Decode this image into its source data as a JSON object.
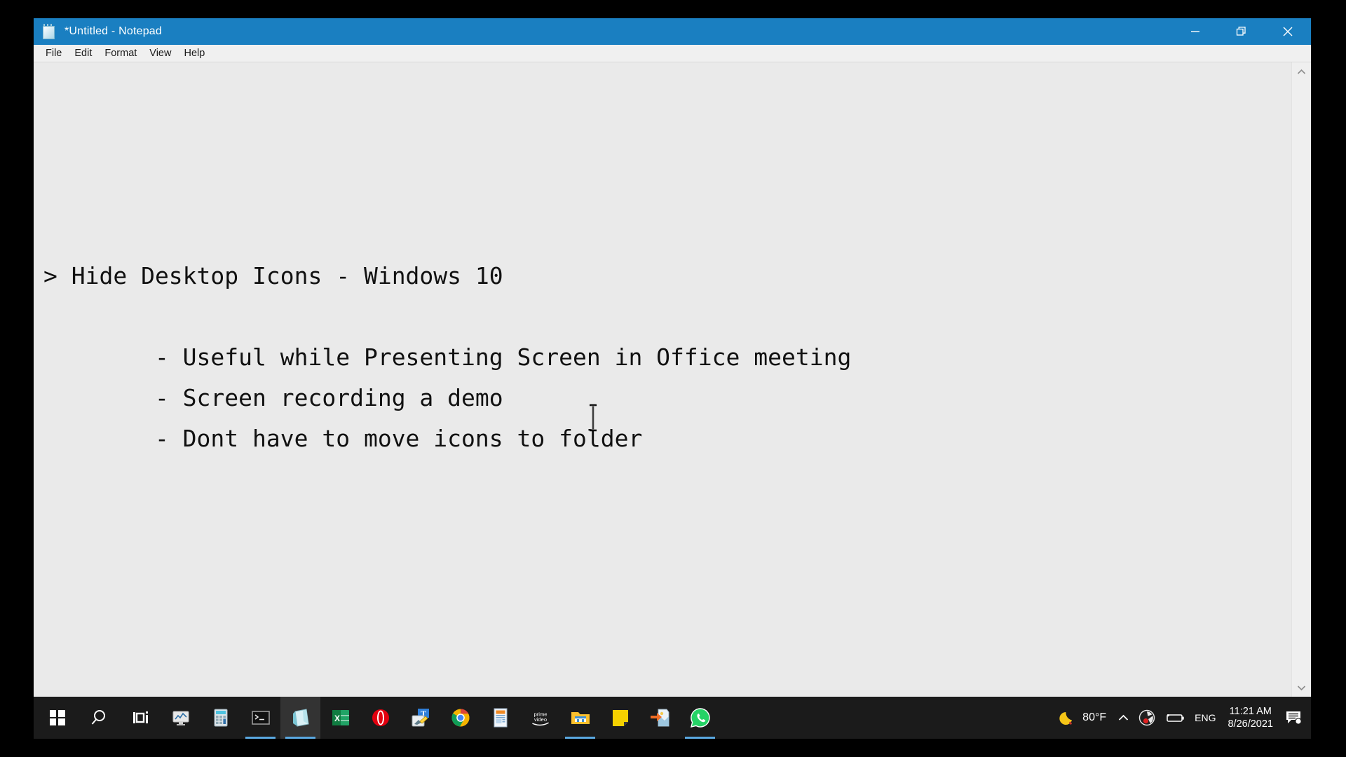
{
  "window": {
    "title": "*Untitled - Notepad",
    "icon": "notepad-icon",
    "menu": [
      {
        "label": "File"
      },
      {
        "label": "Edit"
      },
      {
        "label": "Format"
      },
      {
        "label": "View"
      },
      {
        "label": "Help"
      }
    ],
    "controls": {
      "minimize": "minimize-icon",
      "restore": "restore-icon",
      "close": "close-icon"
    },
    "scrollbar": {
      "up": "chevron-up-icon",
      "down": "chevron-down-icon"
    }
  },
  "document": {
    "heading": "> Hide Desktop Icons - Windows 10",
    "bullets": [
      "        - Useful while Presenting Screen in Office meeting",
      "        - Screen recording a demo",
      "        - Dont have to move icons to folder"
    ],
    "full_text": "> Hide Desktop Icons - Windows 10\n\n        - Useful while Presenting Screen in Office meeting\n        - Screen recording a demo\n        - Dont have to move icons to folder"
  },
  "taskbar": {
    "start": {
      "name": "start-button",
      "icon": "windows-logo-icon"
    },
    "items": [
      {
        "name": "search-button",
        "icon": "search-icon",
        "running": false,
        "active": false
      },
      {
        "name": "task-view-button",
        "icon": "task-view-icon",
        "running": false,
        "active": false
      },
      {
        "name": "task-manager-button",
        "icon": "monitor-chart-icon",
        "running": false,
        "active": false
      },
      {
        "name": "calculator-button",
        "icon": "calculator-icon",
        "running": false,
        "active": false
      },
      {
        "name": "command-prompt-button",
        "icon": "terminal-icon",
        "running": true,
        "active": false
      },
      {
        "name": "notepad-button",
        "icon": "notepad-icon",
        "running": true,
        "active": true
      },
      {
        "name": "excel-button",
        "icon": "excel-icon",
        "running": false,
        "active": false
      },
      {
        "name": "opera-button",
        "icon": "opera-icon",
        "running": false,
        "active": false
      },
      {
        "name": "paint-button",
        "icon": "paint-text-icon",
        "running": false,
        "active": false
      },
      {
        "name": "chrome-button",
        "icon": "chrome-icon",
        "running": false,
        "active": false
      },
      {
        "name": "news-button",
        "icon": "news-document-icon",
        "running": false,
        "active": false
      },
      {
        "name": "prime-video-button",
        "icon": "prime-video-icon",
        "running": false,
        "active": false
      },
      {
        "name": "file-explorer-button",
        "icon": "folder-icon",
        "running": true,
        "active": false
      },
      {
        "name": "sticky-notes-button",
        "icon": "sticky-note-icon",
        "running": false,
        "active": false
      },
      {
        "name": "send-anywhere-button",
        "icon": "file-transfer-icon",
        "running": false,
        "active": false
      },
      {
        "name": "whatsapp-button",
        "icon": "whatsapp-icon",
        "running": true,
        "active": false
      }
    ],
    "tray": {
      "weather_icon": "moon-icon",
      "temperature": "80°F",
      "overflow_icon": "chevron-up-icon",
      "obs_icon": "obs-icon",
      "battery_icon": "battery-icon",
      "language": "ENG",
      "time": "11:21 AM",
      "date": "8/26/2021",
      "notifications_icon": "notification-center-icon"
    }
  },
  "colors": {
    "titlebar": "#1a7fc1",
    "taskbar": "#1b1b1b",
    "editor_bg": "#eaeaea",
    "accent_underline": "#5aa8e0",
    "chrome_bg": "#f0f0f0"
  }
}
